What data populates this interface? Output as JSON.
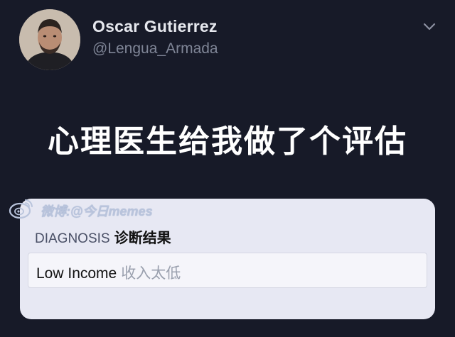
{
  "tweet": {
    "display_name": "Oscar Gutierrez",
    "handle": "@Lengua_Armada",
    "menu_icon": "chevron-down-icon",
    "avatar_icon": "avatar"
  },
  "caption": "心理医生给我做了个评估",
  "card": {
    "watermark": "微博:@今日memes",
    "watermark_icon": "weibo-logo-icon",
    "diagnosis_label": "DIAGNOSIS",
    "diagnosis_label_zh": "诊断结果",
    "result_value": "Low Income",
    "result_value_zh": "收入太低"
  },
  "colors": {
    "background": "#171a28",
    "card": "#e7e8f3",
    "caption": "#ffffff",
    "handle": "#7f8596"
  }
}
